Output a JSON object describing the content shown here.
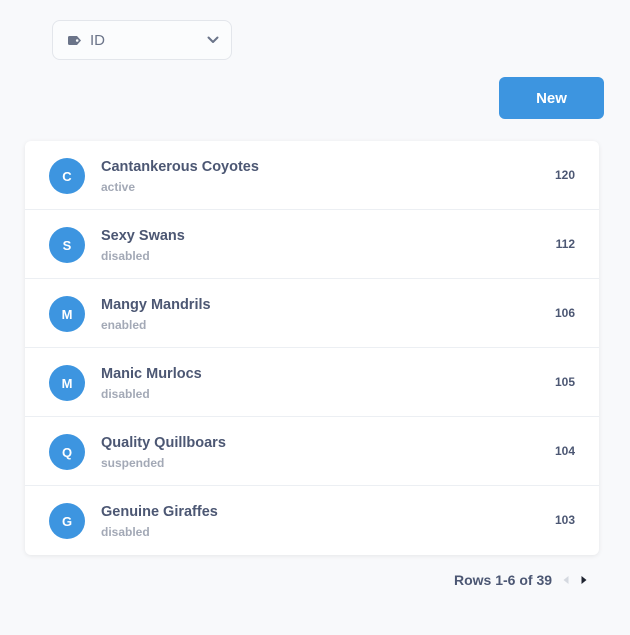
{
  "sort_select": {
    "icon": "tag-icon",
    "value": "ID",
    "chevron_icon": "chevron-down-icon"
  },
  "toolbar": {
    "new_label": "New"
  },
  "list": {
    "rows": [
      {
        "initial": "C",
        "name": "Cantankerous Coyotes",
        "status": "active",
        "count": "120"
      },
      {
        "initial": "S",
        "name": "Sexy Swans",
        "status": "disabled",
        "count": "112"
      },
      {
        "initial": "M",
        "name": "Mangy Mandrils",
        "status": "enabled",
        "count": "106"
      },
      {
        "initial": "M",
        "name": "Manic Murlocs",
        "status": "disabled",
        "count": "105"
      },
      {
        "initial": "Q",
        "name": "Quality Quillboars",
        "status": "suspended",
        "count": "104"
      },
      {
        "initial": "G",
        "name": "Genuine Giraffes",
        "status": "disabled",
        "count": "103"
      }
    ]
  },
  "pagination": {
    "label": "Rows 1-6 of 39",
    "prev_icon": "chevron-left-icon",
    "next_icon": "chevron-right-icon"
  },
  "colors": {
    "accent": "#3d95e0",
    "text": "#4c5773",
    "muted": "#a3a9b6",
    "background": "#f8f9fb"
  }
}
